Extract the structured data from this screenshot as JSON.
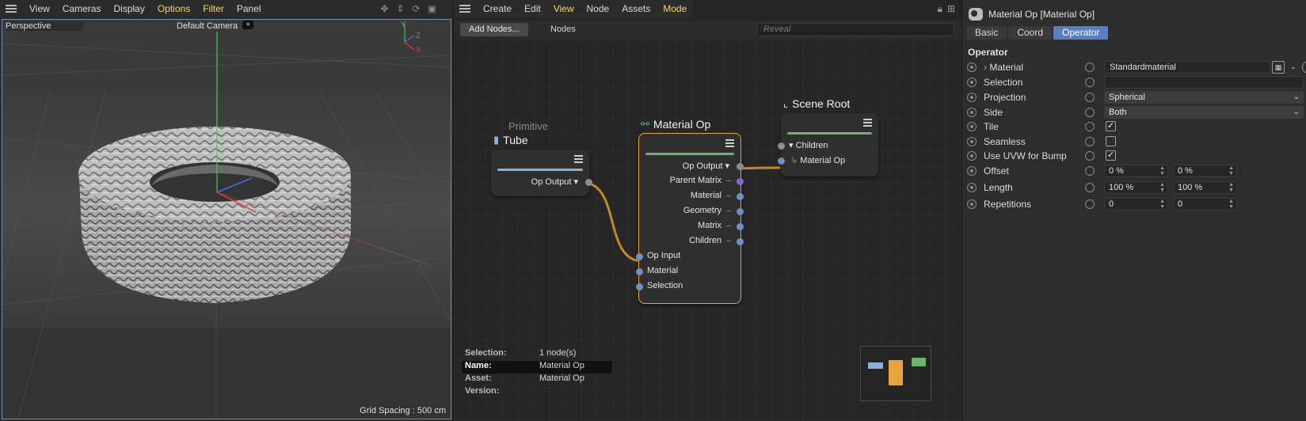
{
  "viewport": {
    "menu": [
      "View",
      "Cameras",
      "Display",
      "Options",
      "Filter",
      "Panel"
    ],
    "projection": "Perspective",
    "camera": "Default Camera",
    "grid_spacing": "Grid Spacing : 500 cm",
    "axes": {
      "y": "Y",
      "z": "Z",
      "x": "X"
    }
  },
  "node_editor": {
    "menu": [
      "Create",
      "Edit",
      "View",
      "Node",
      "Assets",
      "Mode"
    ],
    "add_nodes": "Add Nodes...",
    "nodes_label": "Nodes",
    "reveal_placeholder": "Reveal",
    "nodes": {
      "tube": {
        "category": "Primitive",
        "title": "Tube",
        "output": "Op Output"
      },
      "material_op": {
        "title": "Material Op",
        "outputs": [
          "Op Output",
          "Parent Matrix",
          "Material",
          "Geometry",
          "Matrix",
          "Children"
        ],
        "inputs": [
          "Op Input",
          "Material",
          "Selection"
        ]
      },
      "scene_root": {
        "title": "Scene Root",
        "children": "Children",
        "child_item": "Material Op"
      }
    },
    "info": [
      {
        "key": "Selection:",
        "value": "1 node(s)"
      },
      {
        "key": "Name:",
        "value": "Material Op"
      },
      {
        "key": "Asset:",
        "value": "Material Op"
      },
      {
        "key": "Version:",
        "value": ""
      }
    ]
  },
  "attributes": {
    "title": "Material Op [Material Op]",
    "tabs": [
      "Basic",
      "Coord",
      "Operator"
    ],
    "active_tab": "Operator",
    "section": "Operator",
    "rows": {
      "material": {
        "label": "Material",
        "value": "Standardmaterial"
      },
      "selection": {
        "label": "Selection",
        "value": ""
      },
      "projection": {
        "label": "Projection",
        "value": "Spherical"
      },
      "side": {
        "label": "Side",
        "value": "Both"
      },
      "tile": {
        "label": "Tile",
        "checked": true
      },
      "seamless": {
        "label": "Seamless",
        "checked": false
      },
      "uvw_bump": {
        "label": "Use UVW for Bump",
        "checked": true
      },
      "offset": {
        "label": "Offset",
        "a": "0 %",
        "b": "0 %"
      },
      "length": {
        "label": "Length",
        "a": "100 %",
        "b": "100 %"
      },
      "repetitions": {
        "label": "Repetitions",
        "a": "0",
        "b": "0"
      }
    }
  },
  "colors": {
    "accent": "#5b7fbe",
    "menu_highlight": "#f5d76e",
    "wire": "#c08a2a",
    "node_selected": "#e8a33c",
    "bar_green": "#6fb26a",
    "bar_blue": "#8ab0d8"
  }
}
